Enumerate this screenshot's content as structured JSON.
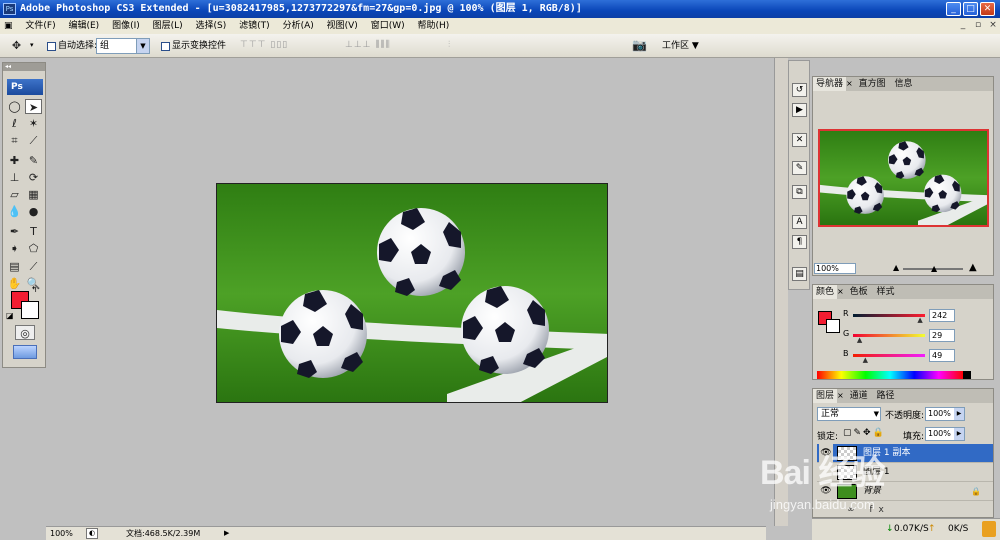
{
  "window": {
    "title": "Adobe Photoshop CS3 Extended - [u=3082417985,1273772297&fm=27&gp=0.jpg @ 100% (图层 1, RGB/8)]",
    "minimize": "_",
    "maximize": "□",
    "close": "✕"
  },
  "menu": [
    "文件(F)",
    "编辑(E)",
    "图像(I)",
    "图层(L)",
    "选择(S)",
    "滤镜(T)",
    "分析(A)",
    "视图(V)",
    "窗口(W)",
    "帮助(H)"
  ],
  "options": {
    "auto_select_label": "自动选择:",
    "auto_select_value": "组",
    "show_transform_label": "显示变换控件",
    "workspace_label": "工作区 ▼"
  },
  "toolbox": {
    "badge": "Ps",
    "foreground_color": "#f21d31"
  },
  "status": {
    "zoom": "100%",
    "doc": "文档:468.5K/2.39M"
  },
  "navigator": {
    "tabs": [
      "导航器",
      "直方图",
      "信息"
    ],
    "zoom": "100%"
  },
  "color": {
    "tabs": [
      "颜色",
      "色板",
      "样式"
    ],
    "channels": [
      {
        "label": "R",
        "value": "242",
        "level": 0.95
      },
      {
        "label": "G",
        "value": "29",
        "level": 0.11
      },
      {
        "label": "B",
        "value": "49",
        "level": 0.19
      }
    ]
  },
  "layers": {
    "tabs": [
      "图层",
      "通道",
      "路径"
    ],
    "blend_mode": "正常",
    "opacity_label": "不透明度:",
    "opacity": "100%",
    "lock_label": "锁定:",
    "fill_label": "填充:",
    "fill": "100%",
    "rows": [
      {
        "name": "图层 1 副本",
        "selected": true
      },
      {
        "name": "图层 1",
        "selected": false
      },
      {
        "name": "背景",
        "selected": false
      }
    ]
  },
  "taskbar": {
    "down": "0.07K/S",
    "up": "0K/S"
  },
  "watermark": {
    "main": "Bai 经验",
    "sub": "jingyan.baidu.com"
  }
}
